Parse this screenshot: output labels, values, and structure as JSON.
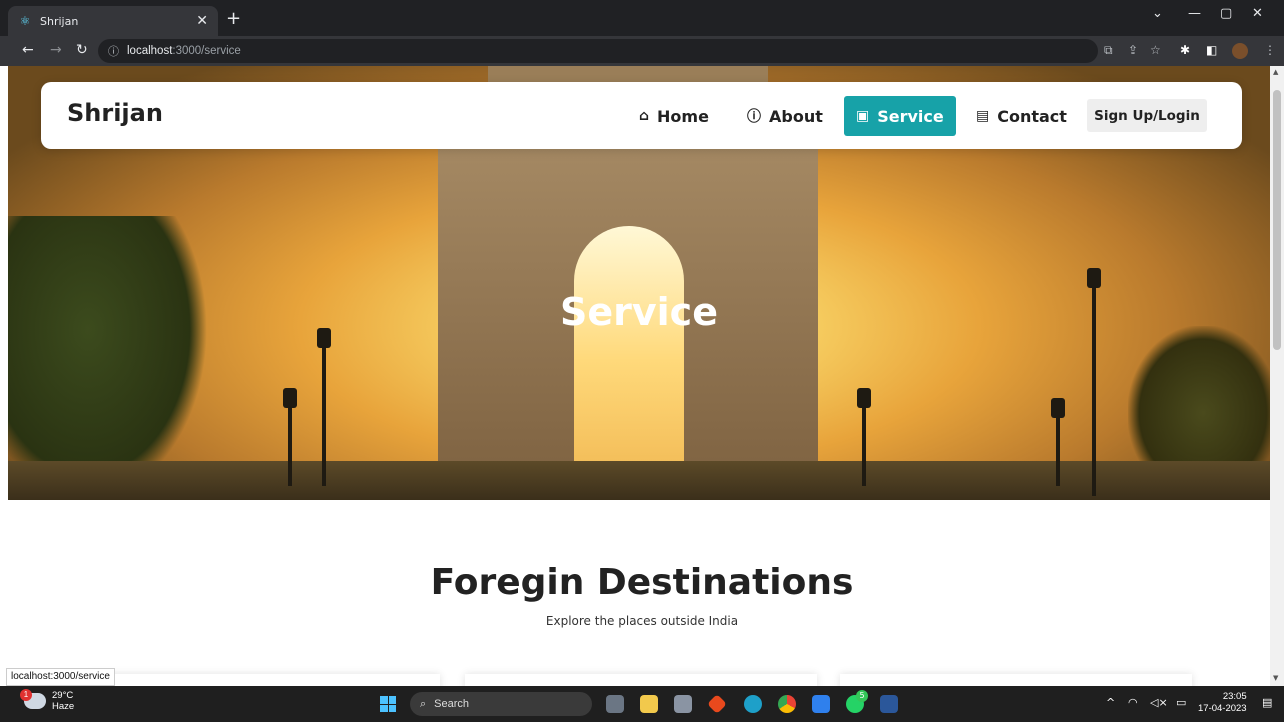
{
  "browser": {
    "tab_title": "Shrijan",
    "url_host": "localhost",
    "url_path": ":3000/service",
    "status_url": "localhost:3000/service"
  },
  "navbar": {
    "brand": "Shrijan",
    "items": [
      {
        "label": "Home",
        "icon": "home-icon"
      },
      {
        "label": "About",
        "icon": "info-icon"
      },
      {
        "label": "Service",
        "icon": "briefcase-icon",
        "active": true
      },
      {
        "label": "Contact",
        "icon": "contact-book-icon"
      }
    ],
    "login_label": "Sign Up/Login",
    "accent_color": "#17a2a8"
  },
  "hero": {
    "title": "Service"
  },
  "section": {
    "title": "Foregin Destinations",
    "subtitle": "Explore the places outside India"
  },
  "taskbar": {
    "weather_temp": "29°C",
    "weather_desc": "Haze",
    "weather_badge": "1",
    "search_label": "Search",
    "whatsapp_badge": "5",
    "time": "23:05",
    "date": "17-04-2023"
  }
}
